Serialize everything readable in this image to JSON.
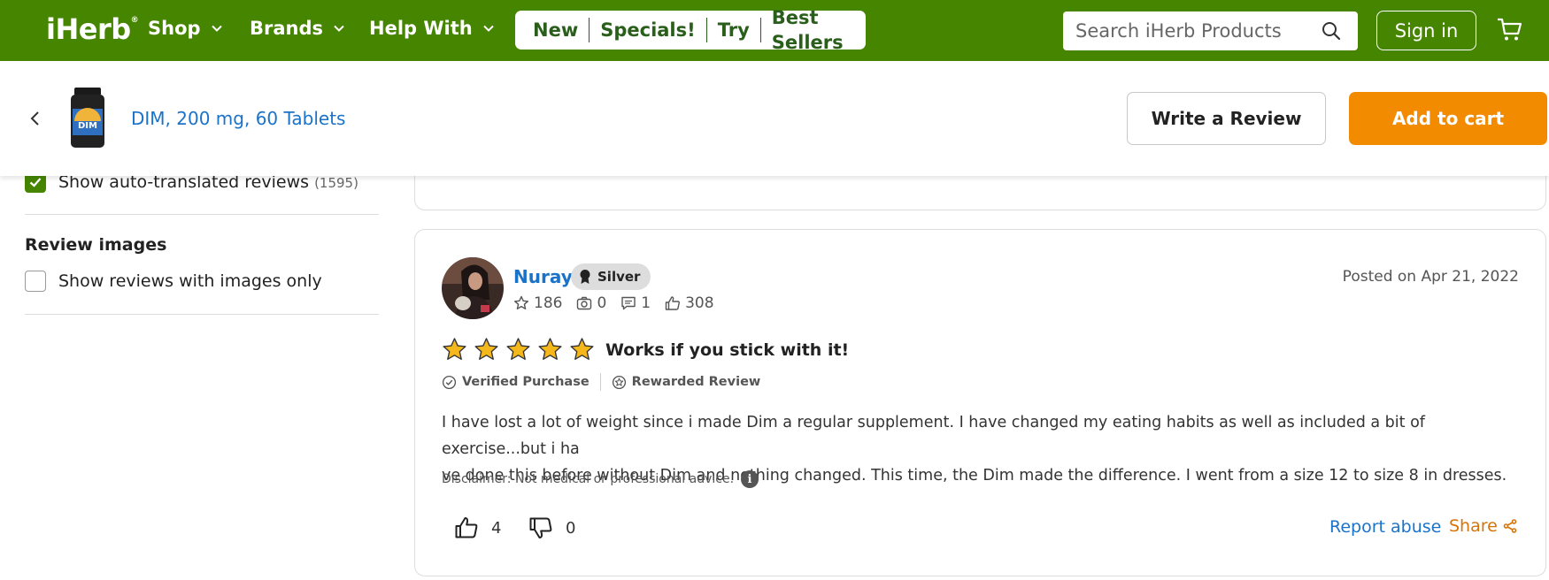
{
  "nav": {
    "logo": "iHerb",
    "logo_mark": "®",
    "links": [
      "Shop",
      "Brands",
      "Help With"
    ],
    "pills": [
      "New",
      "Specials!",
      "Try",
      "Best Sellers"
    ],
    "search_placeholder": "Search iHerb Products",
    "sign_in": "Sign in",
    "brand_color": "#458500"
  },
  "product": {
    "name": "DIM, 200 mg, 60 Tablets",
    "thumb_label": "DIM",
    "write_review": "Write a Review",
    "add_to_cart": "Add to cart",
    "cart_color": "#f28b00"
  },
  "filters": {
    "auto_translated_label": "Show auto-translated reviews",
    "auto_translated_count": "(1595)",
    "auto_translated_checked": true,
    "images_title": "Review images",
    "images_only_label": "Show reviews with images only",
    "images_only_checked": false
  },
  "review": {
    "author": "Nuray",
    "badge": "Silver",
    "stats": {
      "stars": "186",
      "photos": "0",
      "comments": "1",
      "likes": "308"
    },
    "posted": "Posted on Apr 21, 2022",
    "rating": 5,
    "title": "Works if you stick with it!",
    "tags": [
      "Verified Purchase",
      "Rewarded Review"
    ],
    "text_line1": "I have lost a lot of weight since i made Dim a regular supplement. I have changed my eating habits as well as included a bit of exercise...but i ha",
    "text_line2": "ve done this before without Dim and nothing changed. This time, the Dim made the difference. I went from a size 12 to size 8 in dresses.",
    "disclaimer": "Disclaimer: Not medical or professional advice.",
    "info_icon": "i",
    "helpful": "4",
    "unhelpful": "0",
    "report": "Report abuse",
    "share": "Share"
  }
}
